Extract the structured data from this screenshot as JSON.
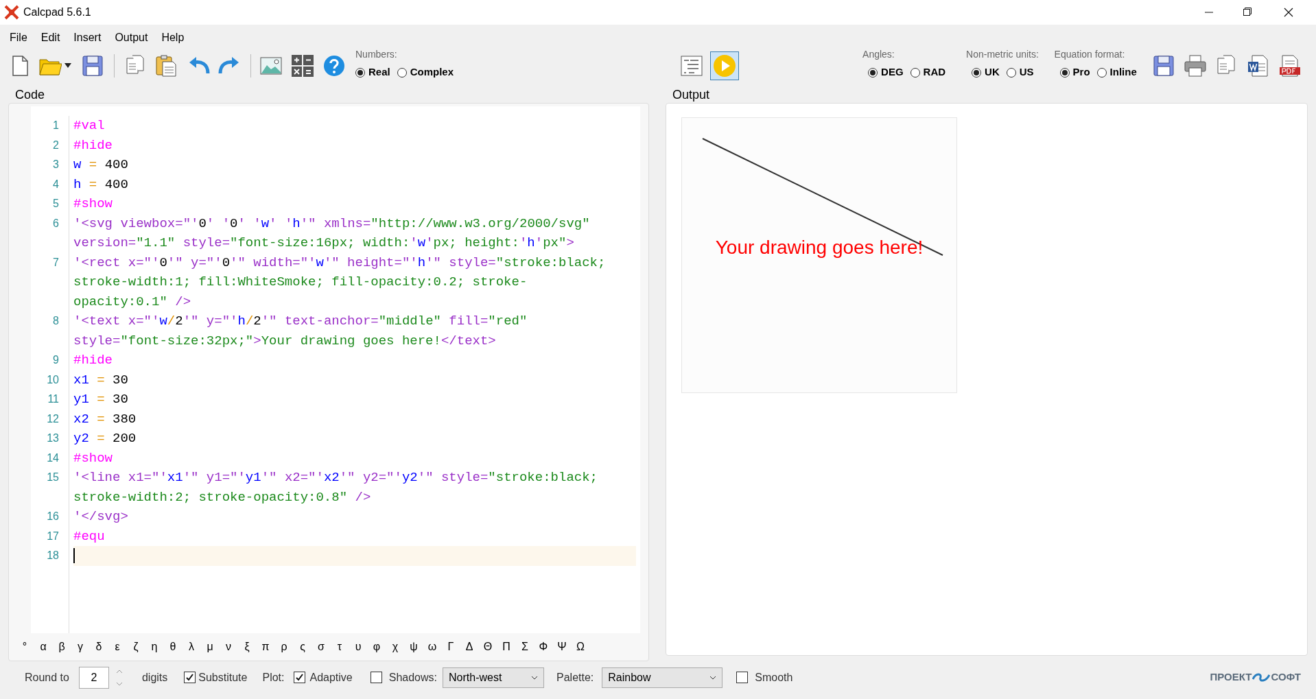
{
  "window": {
    "title": "Calcpad 5.6.1"
  },
  "menu": [
    "File",
    "Edit",
    "Insert",
    "Output",
    "Help"
  ],
  "numbers": {
    "label": "Numbers:",
    "options": [
      {
        "label": "Real",
        "selected": true
      },
      {
        "label": "Complex",
        "selected": false
      }
    ]
  },
  "view_buttons": [
    {
      "kind": "outline",
      "pressed": false
    },
    {
      "kind": "run",
      "pressed": true
    }
  ],
  "option_groups": [
    {
      "label": "Angles:",
      "options": [
        {
          "label": "DEG",
          "selected": true
        },
        {
          "label": "RAD",
          "selected": false
        }
      ]
    },
    {
      "label": "Non-metric units:",
      "options": [
        {
          "label": "UK",
          "selected": true
        },
        {
          "label": "US",
          "selected": false
        }
      ]
    },
    {
      "label": "Equation format:",
      "options": [
        {
          "label": "Pro",
          "selected": true
        },
        {
          "label": "Inline",
          "selected": false
        }
      ]
    }
  ],
  "code": {
    "title": "Code",
    "lines": [
      {
        "number": "1",
        "current": false,
        "rows": [
          {
            "spans": [
              {
                "kind": "kw",
                "text": "#val"
              }
            ]
          }
        ]
      },
      {
        "number": "2",
        "current": false,
        "rows": [
          {
            "spans": [
              {
                "kind": "kw",
                "text": "#hide"
              }
            ]
          }
        ]
      },
      {
        "number": "3",
        "current": false,
        "rows": [
          {
            "spans": [
              {
                "kind": "var",
                "text": "w"
              },
              {
                "kind": "op",
                "text": " = "
              },
              {
                "kind": "num",
                "text": "400"
              }
            ]
          }
        ]
      },
      {
        "number": "4",
        "current": false,
        "rows": [
          {
            "spans": [
              {
                "kind": "var",
                "text": "h"
              },
              {
                "kind": "op",
                "text": " = "
              },
              {
                "kind": "num",
                "text": "400"
              }
            ]
          }
        ]
      },
      {
        "number": "5",
        "current": false,
        "rows": [
          {
            "spans": [
              {
                "kind": "kw",
                "text": "#show"
              }
            ]
          }
        ]
      },
      {
        "number": "6",
        "current": false,
        "rows": [
          {
            "spans": [
              {
                "kind": "tag",
                "text": "'<svg viewbox=\"'"
              },
              {
                "kind": "num",
                "text": "0"
              },
              {
                "kind": "tag",
                "text": "' '"
              },
              {
                "kind": "num",
                "text": "0"
              },
              {
                "kind": "tag",
                "text": "' '"
              },
              {
                "kind": "var",
                "text": "w"
              },
              {
                "kind": "tag",
                "text": "' '"
              },
              {
                "kind": "var",
                "text": "h"
              },
              {
                "kind": "tag",
                "text": "'\" xmlns="
              },
              {
                "kind": "str",
                "text": "\"http://www.w3.org/2000/svg\""
              }
            ]
          },
          {
            "spans": [
              {
                "kind": "tag",
                "text": "version="
              },
              {
                "kind": "str",
                "text": "\"1.1\""
              },
              {
                "kind": "tag",
                "text": " style="
              },
              {
                "kind": "str",
                "text": "\"font-size:16px; width:"
              },
              {
                "kind": "tag",
                "text": "'"
              },
              {
                "kind": "var",
                "text": "w"
              },
              {
                "kind": "tag",
                "text": "'"
              },
              {
                "kind": "str",
                "text": "px; height:"
              },
              {
                "kind": "tag",
                "text": "'"
              },
              {
                "kind": "var",
                "text": "h"
              },
              {
                "kind": "tag",
                "text": "'"
              },
              {
                "kind": "str",
                "text": "px\""
              },
              {
                "kind": "tag",
                "text": ">"
              }
            ]
          }
        ]
      },
      {
        "number": "7",
        "current": false,
        "rows": [
          {
            "spans": [
              {
                "kind": "tag",
                "text": "'<rect x=\"'"
              },
              {
                "kind": "num",
                "text": "0"
              },
              {
                "kind": "tag",
                "text": "'\" y=\"'"
              },
              {
                "kind": "num",
                "text": "0"
              },
              {
                "kind": "tag",
                "text": "'\" width=\"'"
              },
              {
                "kind": "var",
                "text": "w"
              },
              {
                "kind": "tag",
                "text": "'\" height=\"'"
              },
              {
                "kind": "var",
                "text": "h"
              },
              {
                "kind": "tag",
                "text": "'\" style="
              },
              {
                "kind": "str",
                "text": "\"stroke:black;"
              }
            ]
          },
          {
            "spans": [
              {
                "kind": "str",
                "text": "stroke-width:1; fill:WhiteSmoke; fill-opacity:0.2; stroke-"
              }
            ]
          },
          {
            "spans": [
              {
                "kind": "str",
                "text": "opacity:0.1\""
              },
              {
                "kind": "tag",
                "text": " />"
              }
            ]
          }
        ]
      },
      {
        "number": "8",
        "current": false,
        "rows": [
          {
            "spans": [
              {
                "kind": "tag",
                "text": "'<text x=\"'"
              },
              {
                "kind": "var",
                "text": "w"
              },
              {
                "kind": "op",
                "text": "/"
              },
              {
                "kind": "num",
                "text": "2"
              },
              {
                "kind": "tag",
                "text": "'\" y=\"'"
              },
              {
                "kind": "var",
                "text": "h"
              },
              {
                "kind": "op",
                "text": "/"
              },
              {
                "kind": "num",
                "text": "2"
              },
              {
                "kind": "tag",
                "text": "'\" text-anchor="
              },
              {
                "kind": "str",
                "text": "\"middle\""
              },
              {
                "kind": "tag",
                "text": " fill="
              },
              {
                "kind": "str",
                "text": "\"red\""
              }
            ]
          },
          {
            "spans": [
              {
                "kind": "tag",
                "text": "style="
              },
              {
                "kind": "str",
                "text": "\"font-size:32px;\""
              },
              {
                "kind": "tag",
                "text": ">"
              },
              {
                "kind": "str",
                "text": "Your drawing goes here!"
              },
              {
                "kind": "tag",
                "text": "</text>"
              }
            ]
          }
        ]
      },
      {
        "number": "9",
        "current": false,
        "rows": [
          {
            "spans": [
              {
                "kind": "kw",
                "text": "#hide"
              }
            ]
          }
        ]
      },
      {
        "number": "10",
        "current": false,
        "rows": [
          {
            "spans": [
              {
                "kind": "var",
                "text": "x1"
              },
              {
                "kind": "op",
                "text": " = "
              },
              {
                "kind": "num",
                "text": "30"
              }
            ]
          }
        ]
      },
      {
        "number": "11",
        "current": false,
        "rows": [
          {
            "spans": [
              {
                "kind": "var",
                "text": "y1"
              },
              {
                "kind": "op",
                "text": " = "
              },
              {
                "kind": "num",
                "text": "30"
              }
            ]
          }
        ]
      },
      {
        "number": "12",
        "current": false,
        "rows": [
          {
            "spans": [
              {
                "kind": "var",
                "text": "x2"
              },
              {
                "kind": "op",
                "text": " = "
              },
              {
                "kind": "num",
                "text": "380"
              }
            ]
          }
        ]
      },
      {
        "number": "13",
        "current": false,
        "rows": [
          {
            "spans": [
              {
                "kind": "var",
                "text": "y2"
              },
              {
                "kind": "op",
                "text": " = "
              },
              {
                "kind": "num",
                "text": "200"
              }
            ]
          }
        ]
      },
      {
        "number": "14",
        "current": false,
        "rows": [
          {
            "spans": [
              {
                "kind": "kw",
                "text": "#show"
              }
            ]
          }
        ]
      },
      {
        "number": "15",
        "current": false,
        "rows": [
          {
            "spans": [
              {
                "kind": "tag",
                "text": "'<line x1=\"'"
              },
              {
                "kind": "var",
                "text": "x1"
              },
              {
                "kind": "tag",
                "text": "'\" y1=\"'"
              },
              {
                "kind": "var",
                "text": "y1"
              },
              {
                "kind": "tag",
                "text": "'\" x2=\"'"
              },
              {
                "kind": "var",
                "text": "x2"
              },
              {
                "kind": "tag",
                "text": "'\" y2=\"'"
              },
              {
                "kind": "var",
                "text": "y2"
              },
              {
                "kind": "tag",
                "text": "'\" style="
              },
              {
                "kind": "str",
                "text": "\"stroke:black;"
              }
            ]
          },
          {
            "spans": [
              {
                "kind": "str",
                "text": "stroke-width:2; stroke-opacity:0.8\""
              },
              {
                "kind": "tag",
                "text": " />"
              }
            ]
          }
        ]
      },
      {
        "number": "16",
        "current": false,
        "rows": [
          {
            "spans": [
              {
                "kind": "tag",
                "text": "'</svg>"
              }
            ]
          }
        ]
      },
      {
        "number": "17",
        "current": false,
        "rows": [
          {
            "spans": [
              {
                "kind": "kw",
                "text": "#equ"
              }
            ]
          }
        ]
      },
      {
        "number": "18",
        "current": true
      }
    ]
  },
  "symbols": [
    "°",
    "α",
    "β",
    "γ",
    "δ",
    "ε",
    "ζ",
    "η",
    "θ",
    "λ",
    "μ",
    "ν",
    "ξ",
    "π",
    "ρ",
    "ς",
    "σ",
    "τ",
    "υ",
    "φ",
    "χ",
    "ψ",
    "ω",
    "Γ",
    "Δ",
    "Θ",
    "Π",
    "Σ",
    "Φ",
    "Ψ",
    "Ω"
  ],
  "output": {
    "title": "Output",
    "drawing_text": "Your drawing goes here!"
  },
  "status_bar": {
    "round_label": "Round to",
    "round_value": "2",
    "digits_label": "digits",
    "substitute": {
      "label": "Substitute",
      "checked": true
    },
    "plot_label": "Plot:",
    "adaptive": {
      "label": "Adaptive",
      "checked": true
    },
    "shadows": {
      "label": "Shadows:",
      "checked": false,
      "value": "North-west"
    },
    "palette": {
      "label": "Palette:",
      "value": "Rainbow"
    },
    "smooth": {
      "label": "Smooth",
      "checked": false
    },
    "logo": [
      "ПРОЕКТ",
      "СОФТ"
    ]
  }
}
